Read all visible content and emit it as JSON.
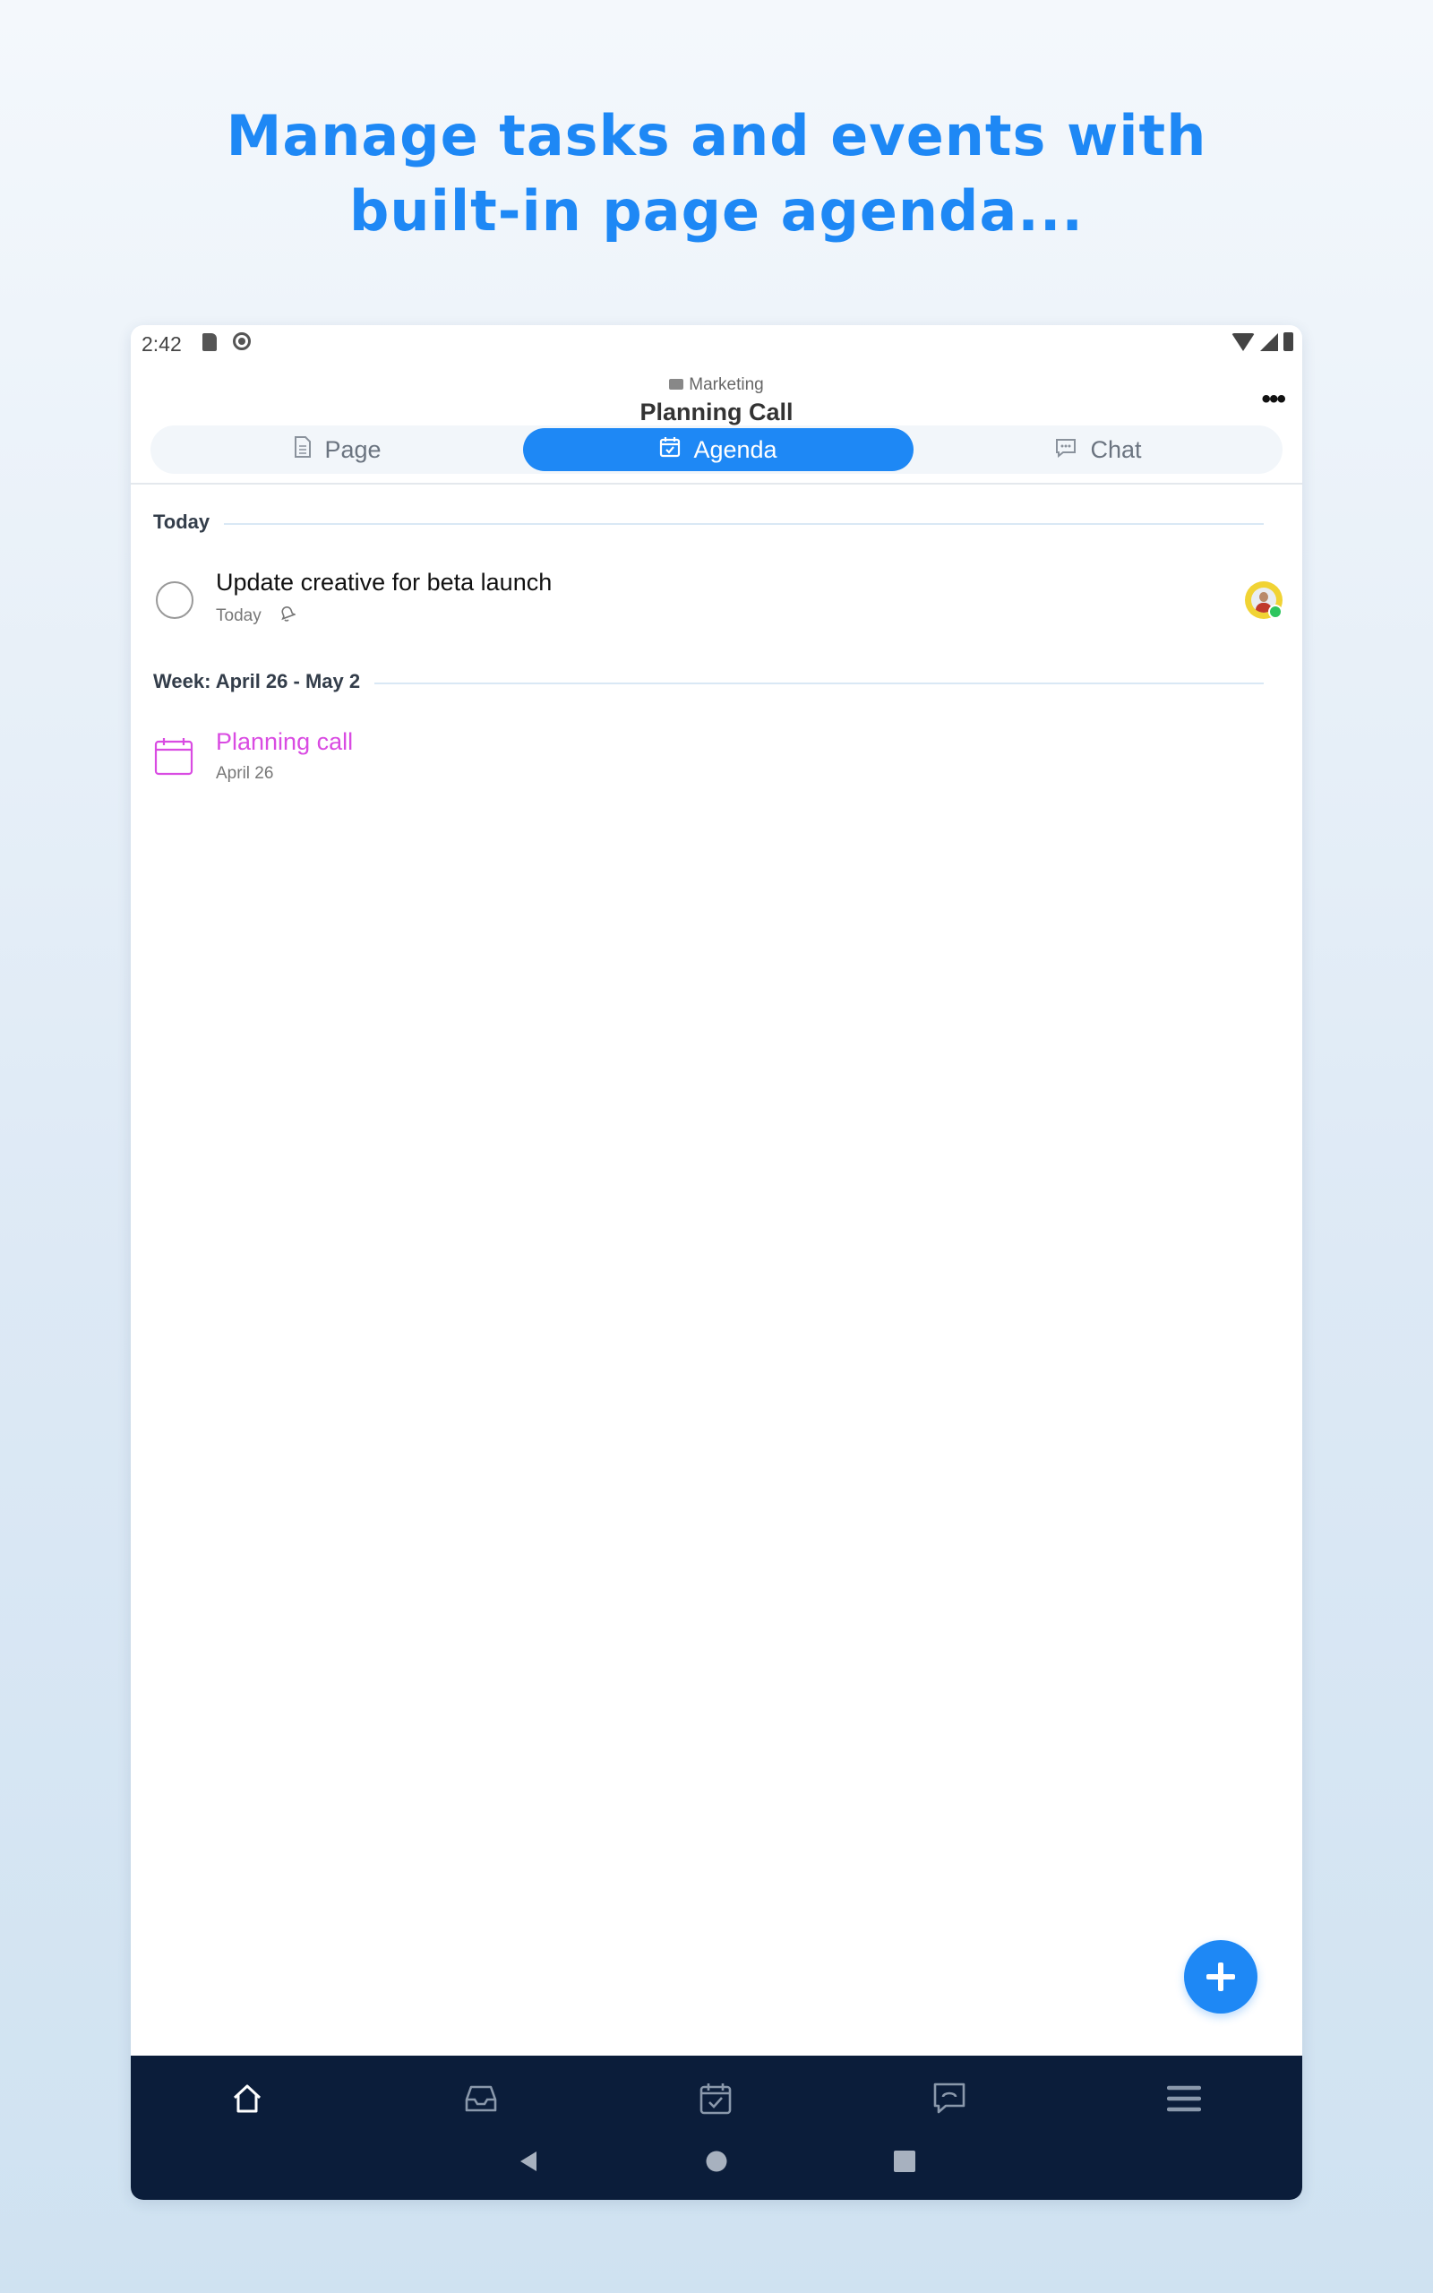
{
  "headline": {
    "line1": "Manage tasks and events with",
    "line2": "built-in page agenda..."
  },
  "status_bar": {
    "time": "2:42"
  },
  "header": {
    "breadcrumb": "Marketing",
    "title": "Planning Call",
    "more_label": "•••"
  },
  "tabs": [
    {
      "label": "Page",
      "icon": "document-icon",
      "active": false
    },
    {
      "label": "Agenda",
      "icon": "calendar-check-icon",
      "active": true
    },
    {
      "label": "Chat",
      "icon": "chat-bubble-icon",
      "active": false
    }
  ],
  "agenda": {
    "sections": [
      {
        "title": "Today",
        "items": [
          {
            "type": "task",
            "name": "Update creative for beta launch",
            "meta": "Today",
            "meta_icon": "bell-icon",
            "assignee": "avatar"
          }
        ]
      },
      {
        "title": "Week: April 26 - May 2",
        "items": [
          {
            "type": "event",
            "name": "Planning call",
            "date": "April 26",
            "icon": "calendar-icon"
          }
        ]
      }
    ]
  },
  "bottom_nav": [
    "home-icon",
    "inbox-icon",
    "calendar-check-icon",
    "chat-icon",
    "menu-icon"
  ],
  "system_nav": [
    "back-icon",
    "home-circle-icon",
    "recents-icon"
  ],
  "colors": {
    "accent": "#1e88f5",
    "event": "#d94be2",
    "nav_bg": "#0b1d3a",
    "online": "#2ec55e"
  }
}
